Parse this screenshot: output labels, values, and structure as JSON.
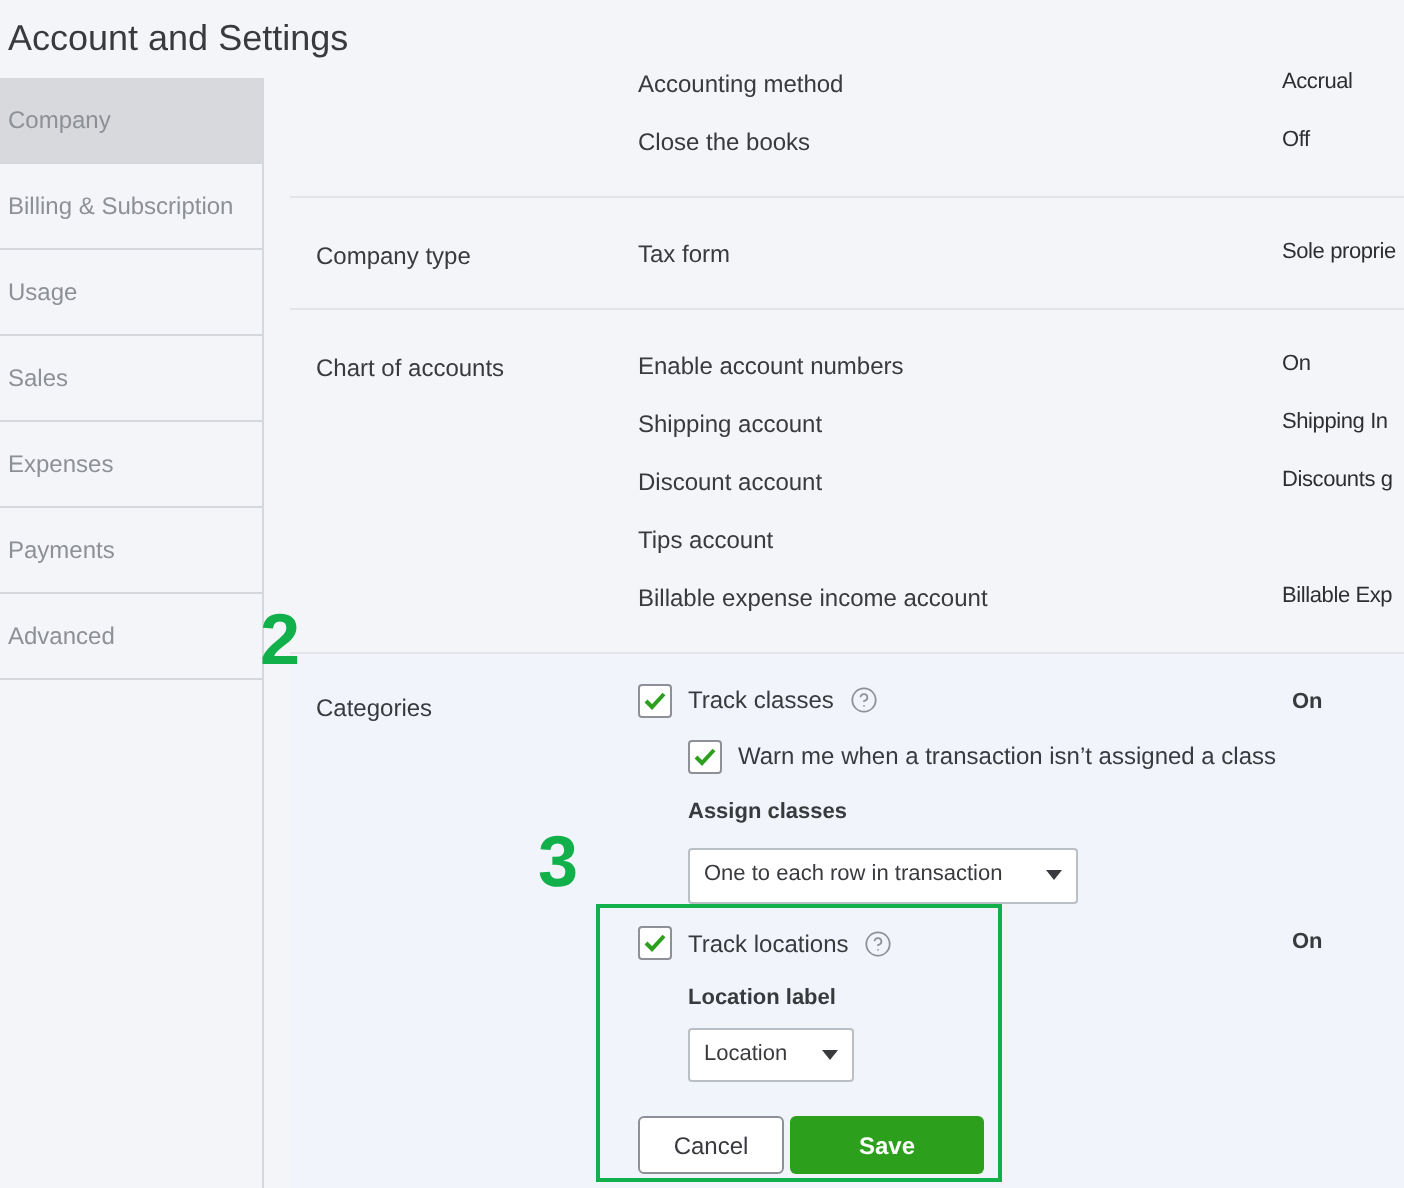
{
  "title": "Account and Settings",
  "sidebar": {
    "items": [
      {
        "label": "Company",
        "selected": true
      },
      {
        "label": "Billing & Subscription",
        "selected": false
      },
      {
        "label": "Usage",
        "selected": false
      },
      {
        "label": "Sales",
        "selected": false
      },
      {
        "label": "Expenses",
        "selected": false
      },
      {
        "label": "Payments",
        "selected": false
      },
      {
        "label": "Advanced",
        "selected": false
      }
    ]
  },
  "sections": [
    {
      "rows": [
        {
          "label": "Accounting method",
          "value": "Accrual"
        },
        {
          "label": "Close the books",
          "value": "Off"
        }
      ]
    },
    {
      "label": "Company type",
      "rows": [
        {
          "label": "Tax form",
          "value": "Sole proprie"
        }
      ]
    },
    {
      "label": "Chart of accounts",
      "rows": [
        {
          "label": "Enable account numbers",
          "value": "On"
        },
        {
          "label": "Shipping account",
          "value": "Shipping In"
        },
        {
          "label": "Discount account",
          "value": "Discounts g"
        },
        {
          "label": "Tips account"
        },
        {
          "label": "Billable expense income account",
          "value": "Billable Exp"
        }
      ]
    }
  ],
  "categories": {
    "label": "Categories",
    "annotation": "2",
    "track_classes": {
      "label": "Track classes",
      "checked": true,
      "value": "On",
      "warn": {
        "label": "Warn me when a transaction isn’t assigned a class",
        "checked": true
      },
      "assign_label": "Assign classes",
      "assign_value": "One to each row in transaction"
    },
    "track_locations": {
      "annotation": "3",
      "label": "Track locations",
      "checked": true,
      "value": "On",
      "location_label": "Location label",
      "location_value": "Location"
    },
    "buttons": {
      "cancel": "Cancel",
      "save": "Save"
    }
  }
}
